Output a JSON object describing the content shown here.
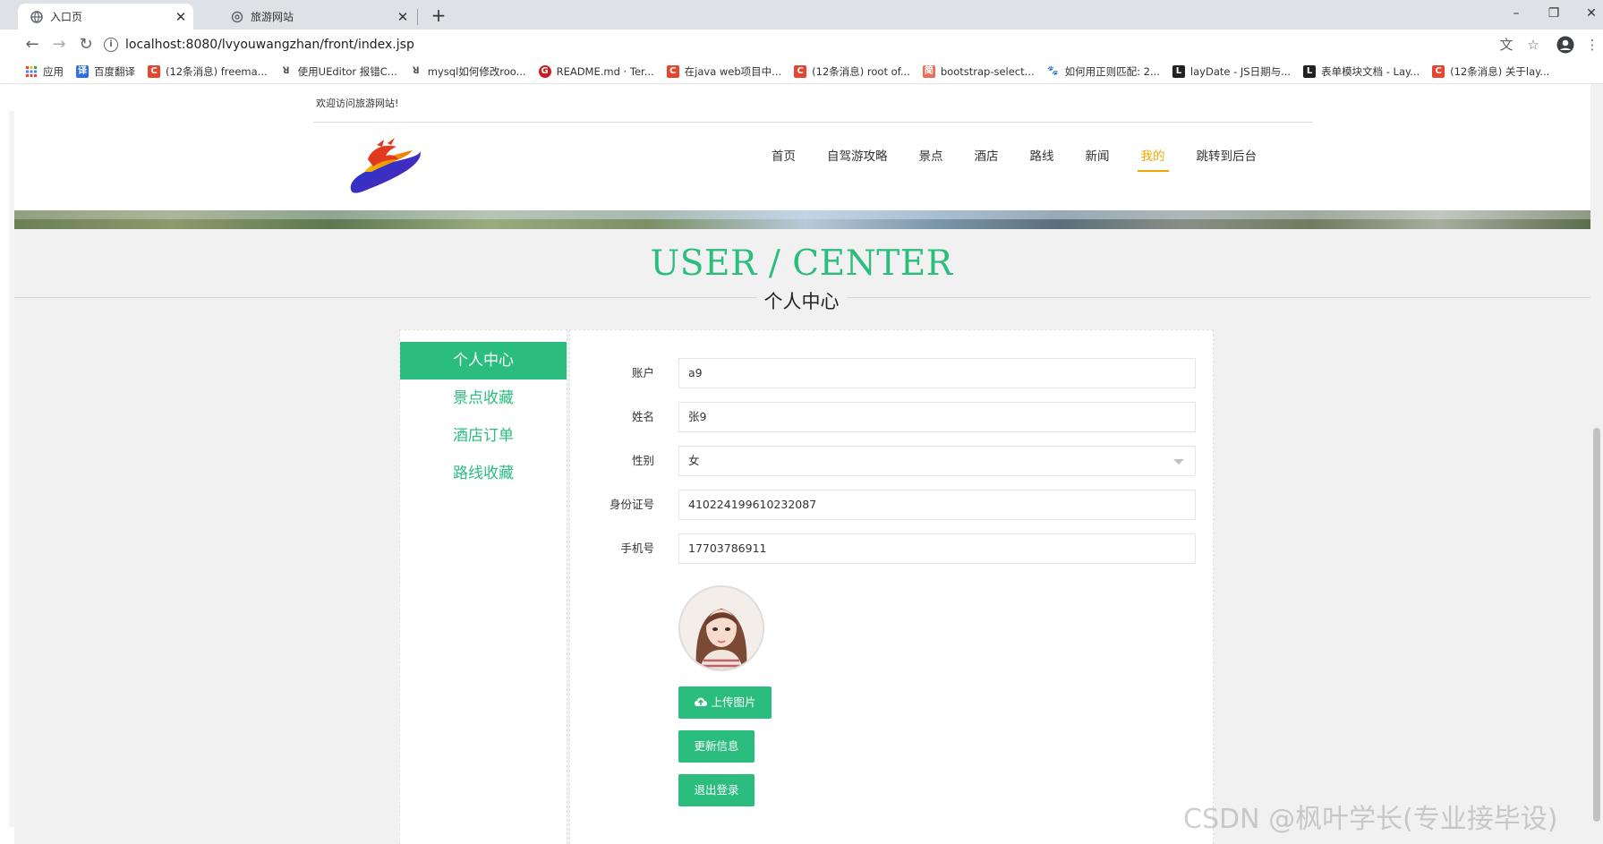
{
  "browser": {
    "tabs": [
      {
        "title": "入口页",
        "icon": "globe-icon",
        "active": true
      },
      {
        "title": "旅游网站",
        "icon": "settings-icon",
        "active": false
      }
    ],
    "new_tab": "+",
    "url": "localhost:8080/lvyouwangzhan/front/index.jsp",
    "window_controls": {
      "minimize": "–",
      "restore": "❐",
      "close": "✕"
    },
    "bookmarks": [
      {
        "label": "应用",
        "icon": "apps-grid-icon",
        "color": "#4285f4"
      },
      {
        "label": "百度翻译",
        "icon": "translate-icon",
        "color": "#2d6fe6"
      },
      {
        "label": "(12条消息) freema...",
        "icon": "csdn-icon",
        "color": "#e4472f"
      },
      {
        "label": "使用UEditor 报错C...",
        "icon": "link-icon",
        "color": "#555555"
      },
      {
        "label": "mysql如何修改roo...",
        "icon": "link-icon",
        "color": "#555555"
      },
      {
        "label": "README.md · Ter...",
        "icon": "gitee-icon",
        "color": "#c71d23"
      },
      {
        "label": "在java web项目中...",
        "icon": "csdn-icon",
        "color": "#e4472f"
      },
      {
        "label": "(12条消息) root of...",
        "icon": "csdn-icon",
        "color": "#e4472f"
      },
      {
        "label": "bootstrap-select...",
        "icon": "jianshu-icon",
        "color": "#ea6f5a"
      },
      {
        "label": "如何用正则匹配: 2...",
        "icon": "baidu-icon",
        "color": "#2932e1"
      },
      {
        "label": "layDate - JS日期与...",
        "icon": "layui-icon",
        "color": "#222222"
      },
      {
        "label": "表单模块文档 - Lay...",
        "icon": "layui-icon",
        "color": "#222222"
      },
      {
        "label": "(12条消息) 关于lay...",
        "icon": "csdn-icon",
        "color": "#e4472f"
      }
    ]
  },
  "site": {
    "welcome": "欢迎访问旅游网站!",
    "nav": [
      {
        "label": "首页",
        "active": false
      },
      {
        "label": "自驾游攻略",
        "active": false
      },
      {
        "label": "景点",
        "active": false
      },
      {
        "label": "酒店",
        "active": false
      },
      {
        "label": "路线",
        "active": false
      },
      {
        "label": "新闻",
        "active": false
      },
      {
        "label": "我的",
        "active": true
      },
      {
        "label": "跳转到后台",
        "active": false
      }
    ],
    "accent_color": "#2bbd7e",
    "nav_active_color": "#f0a500"
  },
  "user_center": {
    "title_en": "USER / CENTER",
    "title_cn": "个人中心",
    "sidebar": [
      {
        "label": "个人中心",
        "active": true
      },
      {
        "label": "景点收藏",
        "active": false
      },
      {
        "label": "酒店订单",
        "active": false
      },
      {
        "label": "路线收藏",
        "active": false
      }
    ],
    "form": {
      "account": {
        "label": "账户",
        "value": "a9"
      },
      "name": {
        "label": "姓名",
        "value": "张9"
      },
      "gender": {
        "label": "性别",
        "value": "女"
      },
      "id_card": {
        "label": "身份证号",
        "value": "410224199610232087"
      },
      "phone": {
        "label": "手机号",
        "value": "17703786911"
      }
    },
    "buttons": {
      "upload": "上传图片",
      "update": "更新信息",
      "logout": "退出登录"
    }
  },
  "watermark": "CSDN @枫叶学长(专业接毕设)"
}
